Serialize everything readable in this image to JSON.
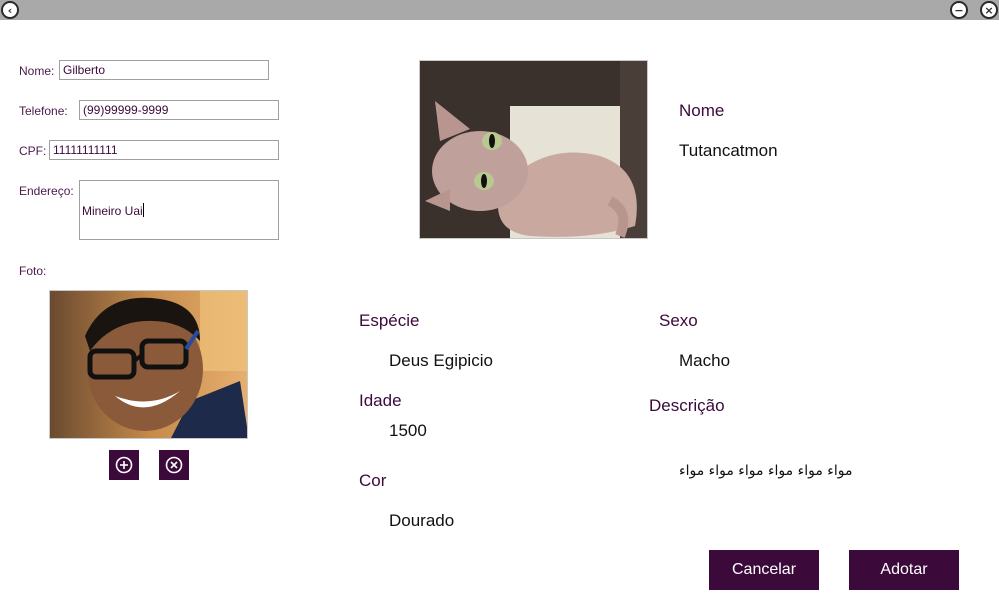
{
  "window": {
    "back_icon": "chevron-left-icon",
    "minimize_icon": "minus-circle-icon",
    "close_icon": "close-circle-icon"
  },
  "adopter": {
    "name_label": "Nome:",
    "name_value": "Gilberto",
    "phone_label": "Telefone:",
    "phone_value": "(99)99999-9999",
    "cpf_label": "CPF:",
    "cpf_value": "11111111111",
    "address_label": "Endereço:",
    "address_value": "Mineiro Uai",
    "photo_label": "Foto:",
    "add_photo_icon": "plus-circle-icon",
    "remove_photo_icon": "x-circle-icon"
  },
  "pet": {
    "name_label": "Nome",
    "name_value": "Tutancatmon",
    "species_label": "Espécie",
    "species_value": "Deus Egipicio",
    "sex_label": "Sexo",
    "sex_value": "Macho",
    "age_label": "Idade",
    "age_value": "1500",
    "description_label": "Descrição",
    "description_value": "مواء مواء مواء مواء مواء مواء",
    "color_label": "Cor",
    "color_value": "Dourado"
  },
  "actions": {
    "cancel_label": "Cancelar",
    "adopt_label": "Adotar"
  },
  "colors": {
    "accent": "#3b0a3b",
    "titlebar": "#a9a9a9"
  }
}
